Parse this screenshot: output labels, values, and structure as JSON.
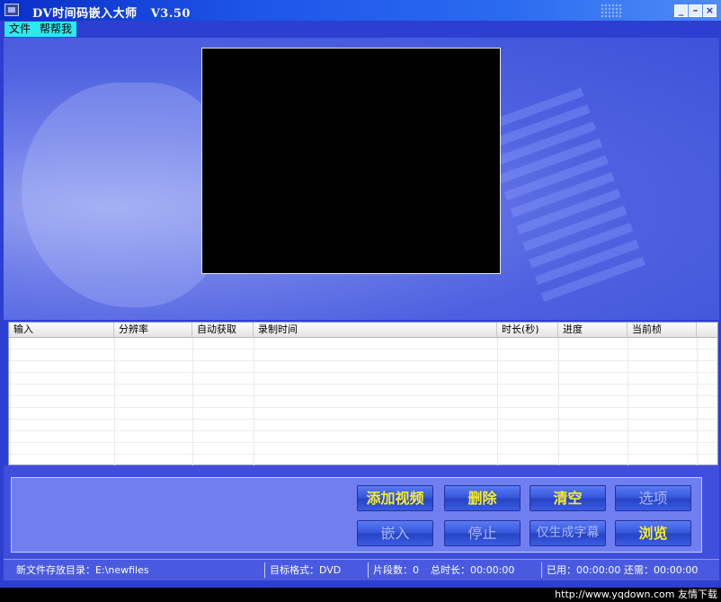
{
  "window": {
    "title": "DV时间码嵌入大师   V3.50"
  },
  "menu": [
    "文件",
    "帮帮我"
  ],
  "table": {
    "columns": [
      "输入",
      "分辨率",
      "自动获取",
      "录制时间",
      "时长(秒)",
      "进度",
      "当前桢"
    ],
    "rows": []
  },
  "buttons": {
    "add_video": "添加视频",
    "delete": "删除",
    "clear": "清空",
    "options": "选项",
    "embed": "嵌入",
    "stop": "停止",
    "subtitle_only": "仅生成字幕",
    "browse": "浏览"
  },
  "status": {
    "output_dir": "新文件存放目录：E:\\newfiles",
    "target_format": "目标格式：DVD",
    "segments": "片段数：0",
    "total_duration": "总时长：00:00:00",
    "used": "已用：00:00:00",
    "remaining": "还需：00:00:00"
  },
  "watermark": "http://www.yqdown.com 友情下载",
  "colors": {
    "button_text": "#f5ec2e",
    "menubar_bg": "#2ee8f0",
    "titlebar": "#1d55e8"
  }
}
